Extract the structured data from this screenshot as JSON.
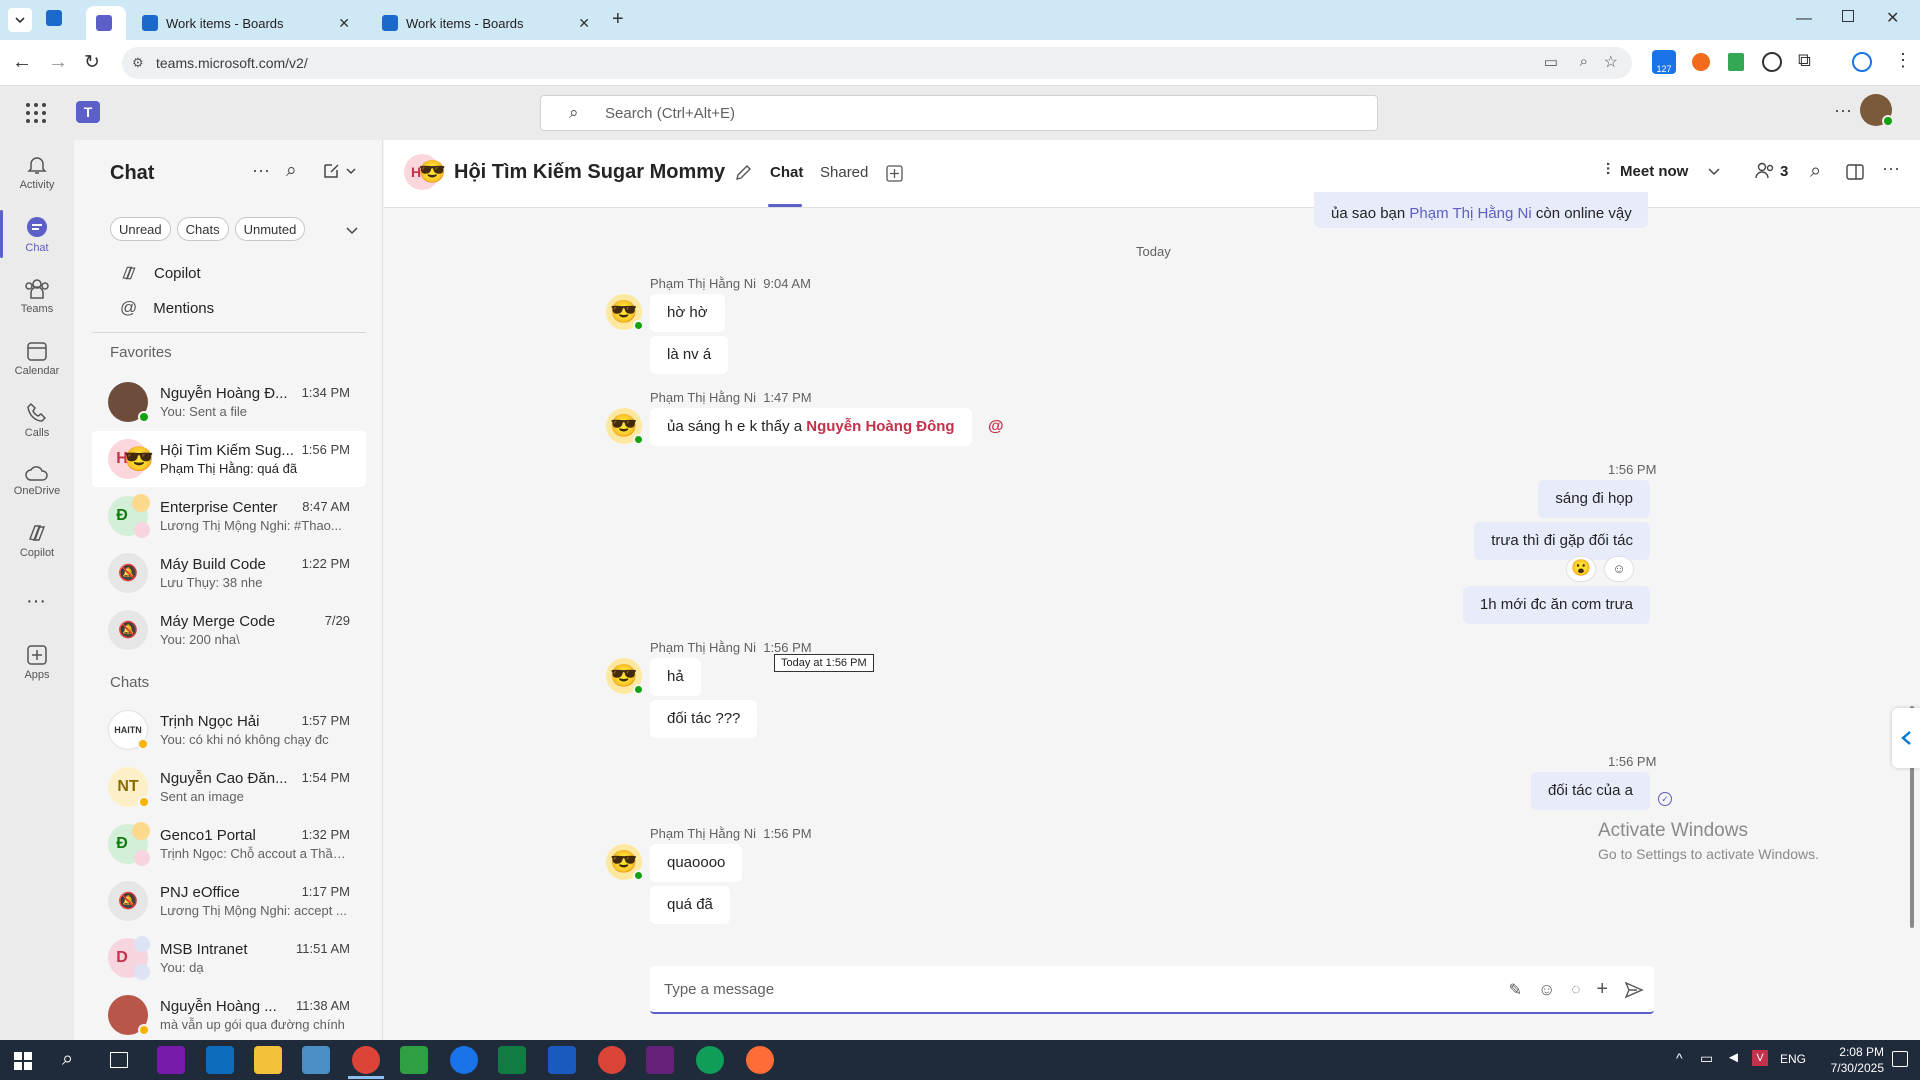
{
  "browser": {
    "tabs": [
      {
        "label": "Work items - Boards"
      },
      {
        "label": "Work items - Boards"
      }
    ],
    "url": "teams.microsoft.com/v2/",
    "badge_count": "127"
  },
  "teams": {
    "search_placeholder": "Search (Ctrl+Alt+E)"
  },
  "rail": [
    {
      "label": "Activity",
      "icon": "bell-icon"
    },
    {
      "label": "Chat",
      "icon": "chat-icon"
    },
    {
      "label": "Teams",
      "icon": "teams-icon"
    },
    {
      "label": "Calendar",
      "icon": "calendar-icon"
    },
    {
      "label": "Calls",
      "icon": "phone-icon"
    },
    {
      "label": "OneDrive",
      "icon": "cloud-icon"
    },
    {
      "label": "Copilot",
      "icon": "copilot-icon"
    },
    {
      "label": "Apps",
      "icon": "add-app-icon"
    }
  ],
  "chatlist": {
    "title": "Chat",
    "filters": [
      "Unread",
      "Chats",
      "Unmuted"
    ],
    "pinned": [
      "Copilot",
      "Mentions"
    ],
    "favorites_label": "Favorites",
    "favorites": [
      {
        "name": "Nguyễn Hoàng Đ...",
        "time": "1:34 PM",
        "preview": "You: Sent a file"
      },
      {
        "name": "Hội Tìm Kiếm Sug...",
        "time": "1:56 PM",
        "preview": "Phạm Thị Hằng: quá đã"
      },
      {
        "name": "Enterprise Center",
        "time": "8:47 AM",
        "preview": "Lương Thị Mộng Nghi: #Thao..."
      },
      {
        "name": "Máy Build Code",
        "time": "1:22 PM",
        "preview": "Lưu Thụy: 38 nhe"
      },
      {
        "name": "Máy Merge Code",
        "time": "7/29",
        "preview": "You: 200 nha\\"
      }
    ],
    "chats_label": "Chats",
    "chats": [
      {
        "name": "Trịnh Ngọc Hải",
        "time": "1:57 PM",
        "preview": "You: có khi nó không chạy đc"
      },
      {
        "name": "Nguyễn Cao Đăn...",
        "time": "1:54 PM",
        "preview": "Sent an image"
      },
      {
        "name": "Genco1 Portal",
        "time": "1:32 PM",
        "preview": "Trịnh Ngọc: Chỗ accout a Thần..."
      },
      {
        "name": "PNJ eOffice",
        "time": "1:17 PM",
        "preview": "Lương Thị Mộng Nghi: accept ..."
      },
      {
        "name": "MSB Intranet",
        "time": "11:51 AM",
        "preview": "You: dạ"
      },
      {
        "name": "Nguyễn Hoàng ...",
        "time": "11:38 AM",
        "preview": "mà vẫn up gói qua đường chính"
      }
    ],
    "avatar_initials": {
      "fav2": "H",
      "ent": "Đ",
      "c2": "NT",
      "genco": "Đ",
      "msb": "D"
    }
  },
  "header": {
    "group_name": "Hội Tìm Kiếm Sugar Mommy",
    "tab_chat": "Chat",
    "tab_shared": "Shared",
    "meet_now": "Meet now",
    "participants": "3"
  },
  "conversation": {
    "top_partial": {
      "prefix": "ủa sao bạn ",
      "mention": "Phạm Thị Hằng Ni",
      "suffix": " còn online vậy"
    },
    "divider": "Today",
    "sender": "Phạm Thị Hằng Ni",
    "groups": [
      {
        "time": "9:04 AM",
        "messages": [
          "hờ hờ",
          "là nv á"
        ]
      },
      {
        "time": "1:47 PM",
        "prefix": "ủa sáng h e k thấy a ",
        "mention": "Nguyễn Hoàng Đông",
        "at": "@"
      },
      {
        "time": "1:56 PM",
        "messages": [
          "sáng đi họp",
          "trưa thì đi gặp đối tác",
          "1h mới đc ăn cơm trưa"
        ]
      },
      {
        "time": "1:56 PM",
        "messages": [
          "hả",
          "đối tác ???"
        ],
        "tooltip": "Today at 1:56 PM"
      },
      {
        "time": "1:56 PM",
        "messages": [
          "đối tác của a"
        ]
      },
      {
        "time": "1:56 PM",
        "messages": [
          "quaoooo",
          "quá đã"
        ]
      }
    ],
    "reaction": "😮"
  },
  "compose": {
    "placeholder": "Type a message"
  },
  "watermark": {
    "line1": "Activate Windows",
    "line2": "Go to Settings to activate Windows."
  },
  "taskbar": {
    "lang": "ENG",
    "time": "2:08 PM",
    "date": "7/30/2025"
  },
  "colors": {
    "accent": "#5b5fc7",
    "mention": "#c4314b",
    "online": "#13a10e",
    "away": "#f7b500"
  }
}
